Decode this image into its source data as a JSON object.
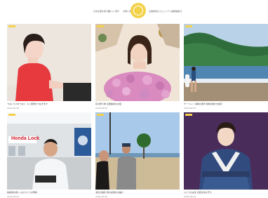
{
  "nav": {
    "items": [
      "日本全国を旅する",
      "紹介人",
      "旅行",
      "お問い合わせ",
      "全国各地のコミュニティとつながる",
      "お知らせ"
    ]
  },
  "cards": [
    {
      "caption": "つないで人をつなぐ 人と場所をつなぎます",
      "meta": "2020.00.00"
    },
    {
      "caption": "花の贈り物 全国各地のお話",
      "meta": "2020.00.00"
    },
    {
      "caption": "サーフィン 海岸の風景 地域の魅力を紹介",
      "meta": "2020.00.00"
    },
    {
      "caption": "技術者の想い ものづくりの現場",
      "meta": "2020.00.00"
    },
    {
      "caption": "海辺の散歩 旅の記録をお届け",
      "meta": "2020.00.00"
    },
    {
      "caption": "ひとりの女性 伝統文化を守る",
      "meta": "2020.00.00"
    }
  ],
  "sign": {
    "text": "Honda Lock"
  },
  "colors": {
    "tag": "#f3d14a",
    "logo": "#f3d24a",
    "red_shirt": "#e63a3f"
  }
}
